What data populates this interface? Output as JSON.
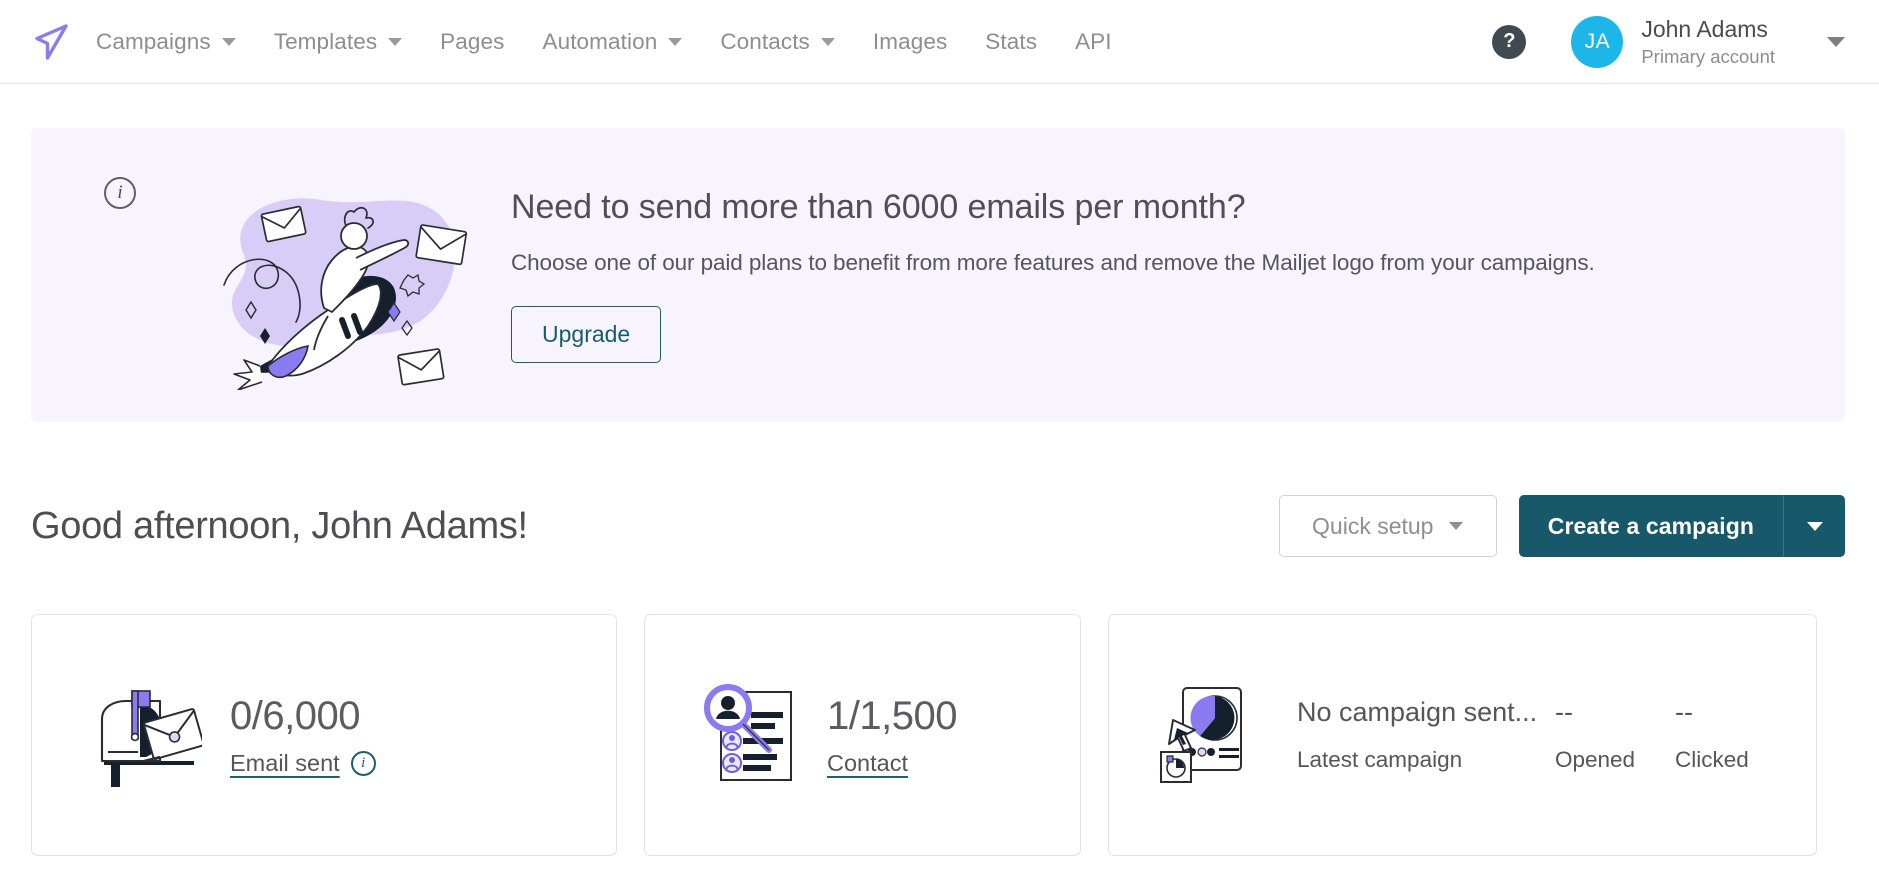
{
  "brand": {
    "logo_icon": "paper-plane-icon",
    "accent_purple": "#8b7bf0",
    "accent_teal": "#17586a",
    "avatar_cyan": "#1cb6e8",
    "banner_bg": "#f7f4fd"
  },
  "nav": {
    "items": [
      {
        "label": "Campaigns",
        "has_caret": true
      },
      {
        "label": "Templates",
        "has_caret": true
      },
      {
        "label": "Pages",
        "has_caret": false
      },
      {
        "label": "Automation",
        "has_caret": true
      },
      {
        "label": "Contacts",
        "has_caret": true
      },
      {
        "label": "Images",
        "has_caret": false
      },
      {
        "label": "Stats",
        "has_caret": false
      },
      {
        "label": "API",
        "has_caret": false
      }
    ],
    "help_label": "?",
    "avatar_initials": "JA",
    "account_name": "John Adams",
    "account_sub": "Primary account"
  },
  "banner": {
    "info_icon_label": "i",
    "title": "Need to send more than 6000 emails per month?",
    "subtitle": "Choose one of our paid plans to benefit from more features and remove the Mailjet logo from your campaigns.",
    "upgrade_label": "Upgrade",
    "illustration": "rocket-rider-envelopes-illustration"
  },
  "greeting": {
    "text": "Good afternoon, John Adams!",
    "quick_setup_label": "Quick setup",
    "create_campaign_label": "Create a campaign"
  },
  "cards": {
    "emails": {
      "illustration": "mailbox-illustration",
      "value": "0/6,000",
      "link_label": "Email sent",
      "info_icon_label": "i"
    },
    "contacts": {
      "illustration": "contact-search-illustration",
      "value": "1/1,500",
      "link_label": "Contact"
    },
    "campaign": {
      "illustration": "campaign-stats-illustration",
      "metrics": [
        {
          "value": "No campaign sent...",
          "label": "Latest campaign"
        },
        {
          "value": "--",
          "label": "Opened"
        },
        {
          "value": "--",
          "label": "Clicked"
        }
      ]
    }
  }
}
